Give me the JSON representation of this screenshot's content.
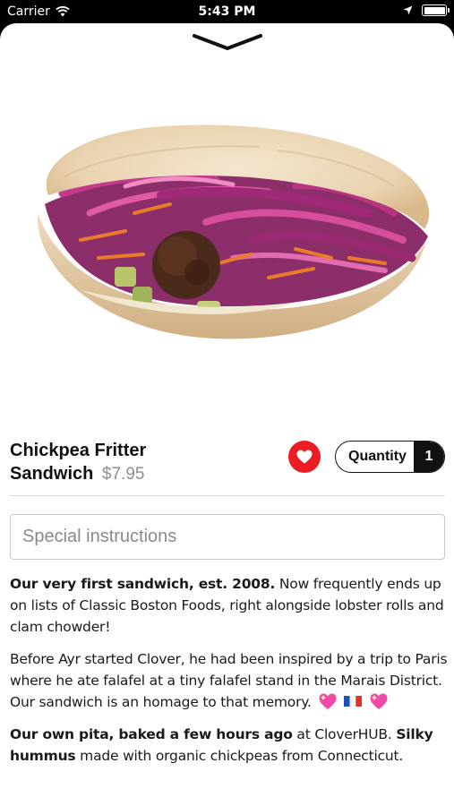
{
  "status_bar": {
    "carrier": "Carrier",
    "time": "5:43 PM"
  },
  "icons": {
    "wifi": "wifi-icon",
    "location": "location-arrow-icon",
    "battery": "battery-icon",
    "dismiss": "chevron-down-icon",
    "favorite": "heart-icon",
    "emoji_heart": "sparkling-heart-emoji",
    "emoji_flag": "france-flag-emoji"
  },
  "item": {
    "title": "Chickpea Fritter Sandwich",
    "price": "$7.95",
    "image": "falafel-pita-sandwich"
  },
  "favorite": {
    "active": true,
    "color": "#ea1c24"
  },
  "quantity": {
    "label": "Quantity",
    "value": "1"
  },
  "instructions": {
    "placeholder": "Special instructions",
    "value": ""
  },
  "description": {
    "p1_bold": "Our very first sandwich, est. 2008.",
    "p1_text": " Now frequently ends up on lists of Classic Boston Foods, right alongside lobster rolls and clam chowder!",
    "p2_text": "Before Ayr started Clover, he had been inspired by a trip to Paris where he ate falafel at a tiny falafel stand in the Marais District. Our sandwich is an homage to that memory.",
    "p3_bold1": "Our own pita, baked a few hours ago",
    "p3_text1": " at CloverHUB. ",
    "p3_bold2": "Silky hummus",
    "p3_text2": " made with organic chickpeas from Connecticut."
  }
}
